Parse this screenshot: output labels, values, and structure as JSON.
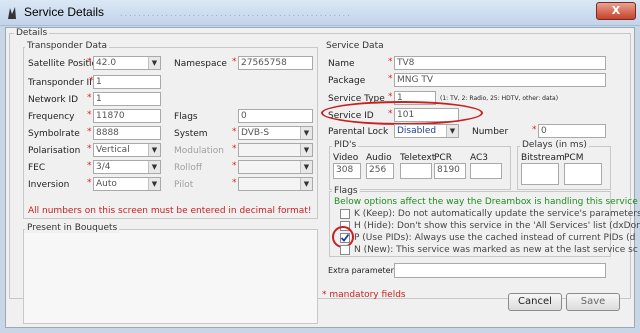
{
  "window": {
    "title": "Service Details",
    "close_label": "X",
    "background_strip": "..................................................."
  },
  "details_group": {
    "title": "Details"
  },
  "transponder": {
    "title": "Transponder Data",
    "satellite_label": "Satellite Positic",
    "satellite_value": "42.0",
    "transponder_id_label": "Transponder II",
    "transponder_id_value": "1",
    "network_id_label": "Network ID",
    "network_id_value": "1",
    "frequency_label": "Frequency",
    "frequency_value": "11870",
    "symbolrate_label": "Symbolrate",
    "symbolrate_value": "8888",
    "polarisation_label": "Polarisation",
    "polarisation_value": "Vertical",
    "fec_label": "FEC",
    "fec_value": "3/4",
    "inversion_label": "Inversion",
    "inversion_value": "Auto",
    "namespace_label": "Namespace",
    "namespace_value": "27565758",
    "flags_label": "Flags",
    "flags_value": "0",
    "system_label": "System",
    "system_value": "DVB-S",
    "modulation_label": "Modulation",
    "rolloff_label": "Rolloff",
    "pilot_label": "Pilot",
    "decimal_note": "All numbers on this screen must be entered in decimal format!"
  },
  "bouquets": {
    "title": "Present in Bouquets"
  },
  "service": {
    "title": "Service Data",
    "name_label": "Name",
    "name_value": "TV8",
    "package_label": "Package",
    "package_value": "MNG TV",
    "type_label": "Service Type",
    "type_value": "1",
    "type_hint": "(1: TV, 2: Radio, 25: HDTV, other: data)",
    "service_id_label": "Service ID",
    "service_id_value": "101",
    "parental_label": "Parental Lock",
    "parental_value": "Disabled",
    "number_label": "Number",
    "number_value": "0"
  },
  "pids": {
    "title": "PID's",
    "video_label": "Video",
    "video_value": "308",
    "audio_label": "Audio",
    "audio_value": "256",
    "teletext_label": "Teletext",
    "teletext_value": "",
    "pcr_label": "PCR",
    "pcr_value": "8190",
    "ac3_label": "AC3",
    "ac3_value": ""
  },
  "delays": {
    "title": "Delays (in ms)",
    "bitstream_label": "Bitstream",
    "bitstream_value": "",
    "pcm_label": "PCM",
    "pcm_value": ""
  },
  "flags": {
    "title": "Flags",
    "note": "Below options affect the way the Dreambox is handling this service",
    "items": [
      {
        "label": "K (Keep): Do not automatically update the service's parameters",
        "checked": false
      },
      {
        "label": "H (Hide): Don't show this service in the 'All Services' list (dxDon",
        "checked": false
      },
      {
        "label": "P (Use PIDs): Always use the cached instead of current PIDs (d",
        "checked": true
      },
      {
        "label": "N (New): This service was marked as new at the last service sc",
        "checked": false
      }
    ]
  },
  "extra": {
    "label": "Extra parameters",
    "value": ""
  },
  "footer": {
    "mandatory_note": "* mandatory fields",
    "cancel_label": "Cancel",
    "save_label": "Save"
  },
  "colors": {
    "required_star": "#d22222",
    "note_red": "#cc2020",
    "flag_note_green": "#1e8c1e",
    "annotation_circle": "#c62020"
  }
}
